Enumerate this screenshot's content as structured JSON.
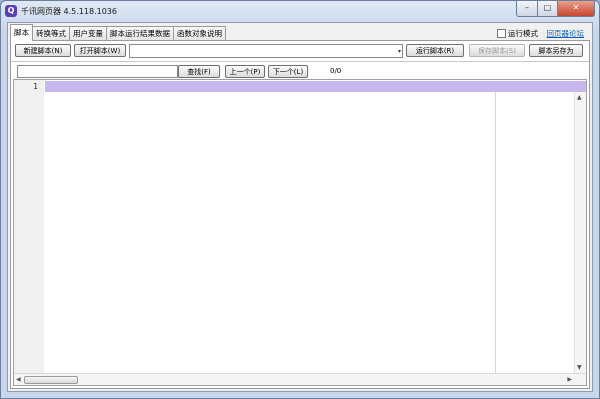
{
  "window": {
    "title": "千讯网页器 4.5.118.1036",
    "app_icon_glyph": "Q",
    "min_glyph": "–",
    "max_glyph": "□",
    "close_glyph": "✕"
  },
  "tabs": [
    {
      "label": "脚本",
      "active": true
    },
    {
      "label": "转换等式",
      "active": false
    },
    {
      "label": "用户变量",
      "active": false
    },
    {
      "label": "脚本运行结果数据",
      "active": false
    },
    {
      "label": "函数对象说明",
      "active": false
    }
  ],
  "header_right": {
    "run_mode_label": "运行模式",
    "run_mode_checked": false,
    "forum_link": "回页器论坛"
  },
  "toolbar": {
    "new_script": "新建脚本(N)",
    "open_script": "打开脚本(W)",
    "script_select_value": "",
    "run_script": "运行脚本(R)",
    "save_script": "保存脚本(S)",
    "save_script_as": "脚本另存为"
  },
  "search": {
    "value": "",
    "find": "查找(F)",
    "prev": "上一个(P)",
    "next": "下一个(L)",
    "count": "0/0"
  },
  "editor": {
    "line_number": "1",
    "content": ""
  },
  "colors": {
    "current_line": "#c6b8ec",
    "close_button": "#c8452c",
    "link": "#0060c0"
  },
  "icons": {
    "combo_arrow": "▾",
    "scroll_up": "▲",
    "scroll_down": "▼",
    "scroll_left": "◀",
    "scroll_right": "▶"
  }
}
